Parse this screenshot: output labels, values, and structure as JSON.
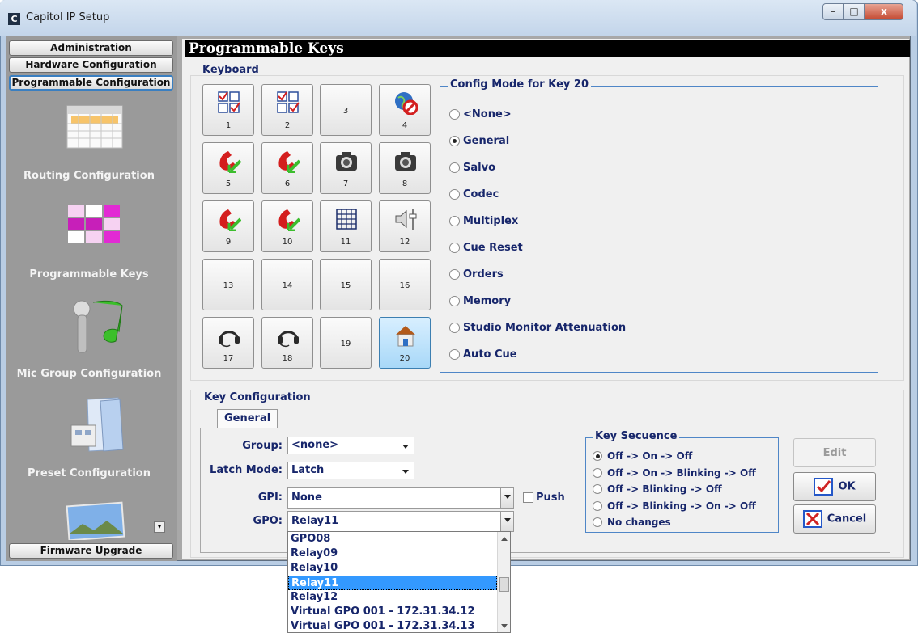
{
  "window": {
    "title": "Capitol IP Setup",
    "app_icon_letter": "C",
    "minimize": "–",
    "maximize": "□",
    "close": "x"
  },
  "sidebar": {
    "tabs": [
      "Administration",
      "Hardware Configuration",
      "Programmable Configuration"
    ],
    "sections": [
      {
        "label": "Routing Configuration",
        "icon": "calendar-grid-icon"
      },
      {
        "label": "Programmable Keys",
        "icon": "pink-grid-icon"
      },
      {
        "label": "Mic Group Configuration",
        "icon": "microphone-music-icon"
      },
      {
        "label": "Preset Configuration",
        "icon": "document-folder-icon"
      }
    ],
    "bottom_tab": "Firmware Upgrade",
    "scroll_arrow": "▾"
  },
  "main": {
    "header": "Programmable Keys",
    "keyboard_title": "Keyboard",
    "keys": [
      {
        "num": "1",
        "icon": "checkbox-grid-icon"
      },
      {
        "num": "2",
        "icon": "checkbox-grid-icon"
      },
      {
        "num": "3",
        "icon": ""
      },
      {
        "num": "4",
        "icon": "globe-blocked-icon"
      },
      {
        "num": "5",
        "icon": "phone-incoming-icon"
      },
      {
        "num": "6",
        "icon": "phone-incoming-icon"
      },
      {
        "num": "7",
        "icon": "camera-icon"
      },
      {
        "num": "8",
        "icon": "camera-icon"
      },
      {
        "num": "9",
        "icon": "phone-incoming-icon"
      },
      {
        "num": "10",
        "icon": "phone-incoming-icon"
      },
      {
        "num": "11",
        "icon": "matrix-grid-icon"
      },
      {
        "num": "12",
        "icon": "speaker-fader-icon"
      },
      {
        "num": "13",
        "icon": ""
      },
      {
        "num": "14",
        "icon": ""
      },
      {
        "num": "15",
        "icon": ""
      },
      {
        "num": "16",
        "icon": ""
      },
      {
        "num": "17",
        "icon": "headset-icon"
      },
      {
        "num": "18",
        "icon": "headset-icon"
      },
      {
        "num": "19",
        "icon": ""
      },
      {
        "num": "20",
        "icon": "home-icon",
        "selected": true
      }
    ],
    "config_mode": {
      "title": "Config Mode for Key 20",
      "options": [
        "<None>",
        "General",
        "Salvo",
        "Codec",
        "Multiplex",
        "Cue Reset",
        "Orders",
        "Memory",
        "Studio Monitor Attenuation",
        "Auto Cue"
      ],
      "selected": "General"
    },
    "key_configuration": {
      "title": "Key Configuration",
      "tab": "General",
      "group_label": "Group:",
      "group_value": "<none>",
      "latch_label": "Latch Mode:",
      "latch_value": "Latch",
      "gpi_label": "GPI:",
      "gpi_value": "None",
      "push_label": "Push",
      "gpo_label": "GPO:",
      "gpo_value": "Relay11",
      "key_sequence": {
        "title": "Key Secuence",
        "options": [
          "Off -> On -> Off",
          "Off -> On -> Blinking -> Off",
          "Off -> Blinking -> Off",
          "Off -> Blinking -> On -> Off",
          "No changes"
        ],
        "selected": "Off -> On -> Off"
      },
      "buttons": {
        "edit": "Edit",
        "ok": "OK",
        "cancel": "Cancel"
      }
    },
    "gpo_dropdown": {
      "items": [
        "GPO08",
        "Relay09",
        "Relay10",
        "Relay11",
        "Relay12",
        "Virtual GPO 001 - 172.31.34.12",
        "Virtual GPO 001 - 172.31.34.13"
      ],
      "selected": "Relay11"
    }
  },
  "colors": {
    "label_navy": "#17266b",
    "sidebar_gray": "#9a9a9a",
    "selected_blue": "#3399ff",
    "cancel_red": "#d02424",
    "ok_blue": "#2457c8"
  }
}
